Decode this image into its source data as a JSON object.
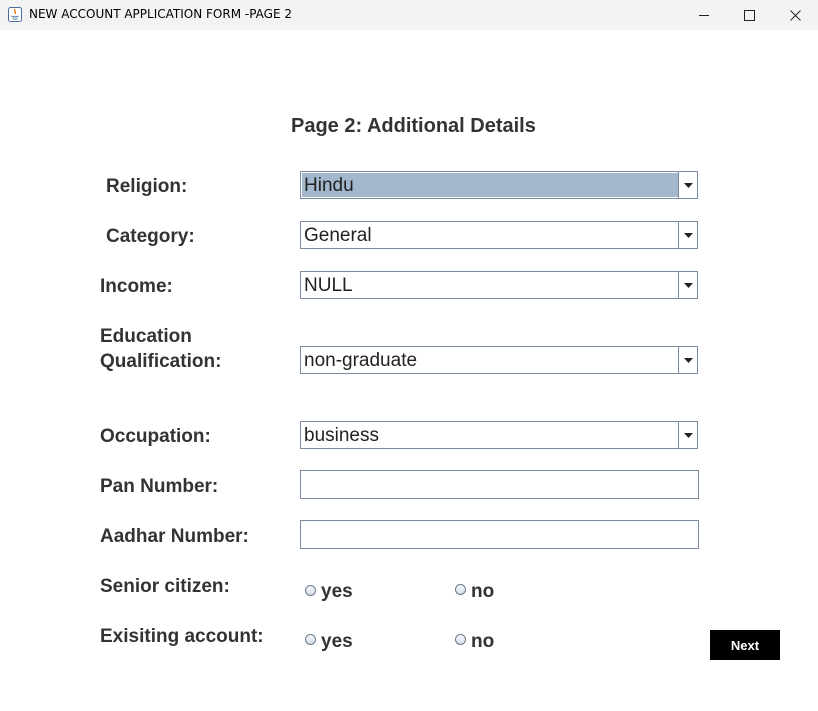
{
  "window": {
    "title": "NEW ACCOUNT APPLICATION FORM -PAGE 2",
    "app_icon": "java-icon",
    "controls": {
      "minimize": "minimize-icon",
      "maximize": "maximize-icon",
      "close": "close-icon"
    }
  },
  "form": {
    "heading": "Page 2: Additional Details",
    "religion": {
      "label": "Religion:",
      "value": "Hindu"
    },
    "category": {
      "label": "Category:",
      "value": "General"
    },
    "income": {
      "label": "Income:",
      "value": "NULL"
    },
    "education": {
      "label_line1": "Education",
      "label_line2": "Qualification:",
      "value": "non-graduate"
    },
    "occupation": {
      "label": "Occupation:",
      "value": "business"
    },
    "pan": {
      "label": "Pan Number:",
      "value": ""
    },
    "aadhar": {
      "label": "Aadhar Number:",
      "value": ""
    },
    "senior_citizen": {
      "label": "Senior citizen:",
      "yes": "yes",
      "no": "no"
    },
    "existing_account": {
      "label": "Exisiting account:",
      "yes": "yes",
      "no": "no"
    },
    "next_label": "Next"
  },
  "colors": {
    "selection": "#a3b8cc",
    "label_text": "#333333",
    "button_bg": "#000000",
    "button_text": "#ffffff"
  }
}
